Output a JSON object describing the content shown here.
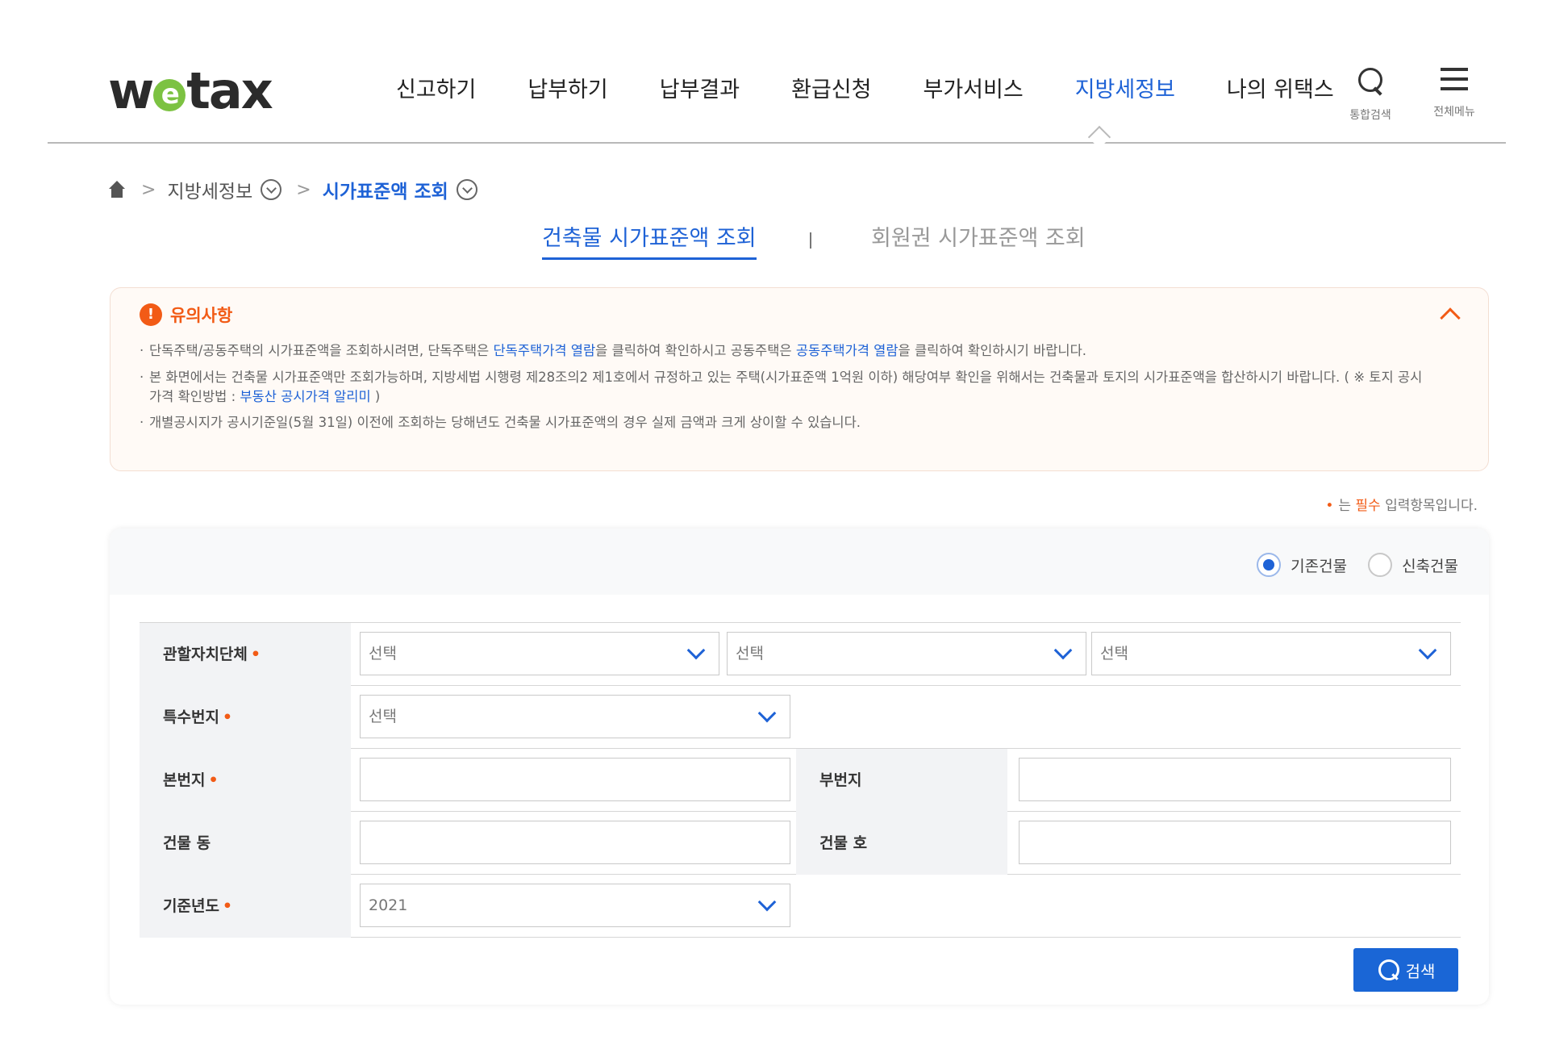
{
  "header": {
    "logo": "wetax",
    "nav": [
      {
        "label": "신고하기"
      },
      {
        "label": "납부하기"
      },
      {
        "label": "납부결과"
      },
      {
        "label": "환급신청"
      },
      {
        "label": "부가서비스"
      },
      {
        "label": "지방세정보",
        "active": true
      },
      {
        "label": "나의 위택스"
      }
    ],
    "util": {
      "search_label": "통합검색",
      "menu_label": "전체메뉴"
    }
  },
  "breadcrumb": {
    "level1": "지방세정보",
    "level2": "시가표준액 조회"
  },
  "tabs": {
    "active": "건축물 시가표준액 조회",
    "inactive": "회원권 시가표준액 조회",
    "divider": "|"
  },
  "notice": {
    "title": "유의사항",
    "items": {
      "i1": {
        "t1": "단독주택/공동주택의 시가표준액을 조회하시려면, 단독주택은 ",
        "link1": "단독주택가격 열람",
        "t2": "을 클릭하여 확인하시고 공동주택은 ",
        "link2": "공동주택가격 열람",
        "t3": "을 클릭하여 확인하시기 바랍니다."
      },
      "i2": {
        "t1": "본 화면에서는 건축물 시가표준액만 조회가능하며, 지방세법 시행령 제28조의2 제1호에서 규정하고 있는 주택(시가표준액 1억원 이하) 해당여부 확인을 위해서는 건축물과 토지의 시가표준액을 합산하시기 바랍니다. ( ※ 토지 공시가격 확인방법 : ",
        "link": "부동산 공시가격 알리미",
        "t2": " )"
      },
      "i3": "개별공시지가 공시기준일(5월 31일) 이전에 조회하는 당해년도 건축물 시가표준액의 경우 실제 금액과 크게 상이할 수 있습니다."
    }
  },
  "required_note": {
    "dot": "•",
    "prefix": "는 ",
    "req": "필수",
    "suffix": " 입력항목입니다."
  },
  "form": {
    "building_type": {
      "options": [
        "기존건물",
        "신축건물"
      ],
      "selected": "기존건물"
    },
    "rows": {
      "jurisdiction": {
        "label": "관할자치단체",
        "required": "•",
        "selects": [
          "선택",
          "선택",
          "선택"
        ]
      },
      "special_lot": {
        "label": "특수번지",
        "required": "•",
        "value": "선택"
      },
      "main_lot": {
        "label": "본번지",
        "required": "•",
        "value": ""
      },
      "sub_lot": {
        "label": "부번지",
        "value": ""
      },
      "building_dong": {
        "label": "건물 동",
        "value": ""
      },
      "building_ho": {
        "label": "건물 호",
        "value": ""
      },
      "base_year": {
        "label": "기준년도",
        "required": "•",
        "value": "2021"
      }
    },
    "search_button": "검색"
  },
  "colors": {
    "accent": "#1e62d6",
    "warning": "#f25b16",
    "logo_e": "#7cc242"
  }
}
